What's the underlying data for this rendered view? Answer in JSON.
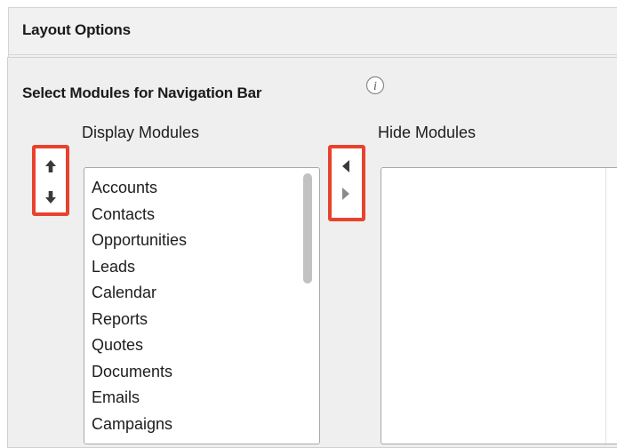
{
  "section": {
    "title": "Layout Options"
  },
  "navigation": {
    "title": "Select Modules for Navigation Bar",
    "info_icon": "info-icon"
  },
  "display_modules": {
    "label": "Display Modules",
    "items": [
      "Accounts",
      "Contacts",
      "Opportunities",
      "Leads",
      "Calendar",
      "Reports",
      "Quotes",
      "Documents",
      "Emails",
      "Campaigns"
    ]
  },
  "hide_modules": {
    "label": "Hide Modules",
    "items": []
  },
  "controls": {
    "move_up_icon": "arrow-up-icon",
    "move_down_icon": "arrow-down-icon",
    "move_left_icon": "triangle-left-icon",
    "move_right_icon": "triangle-right-icon"
  },
  "colors": {
    "highlight": "#e8422e",
    "panel_bg": "#f1f1f1",
    "list_bg": "#ffffff",
    "scroll_thumb": "#c2c2c2"
  }
}
